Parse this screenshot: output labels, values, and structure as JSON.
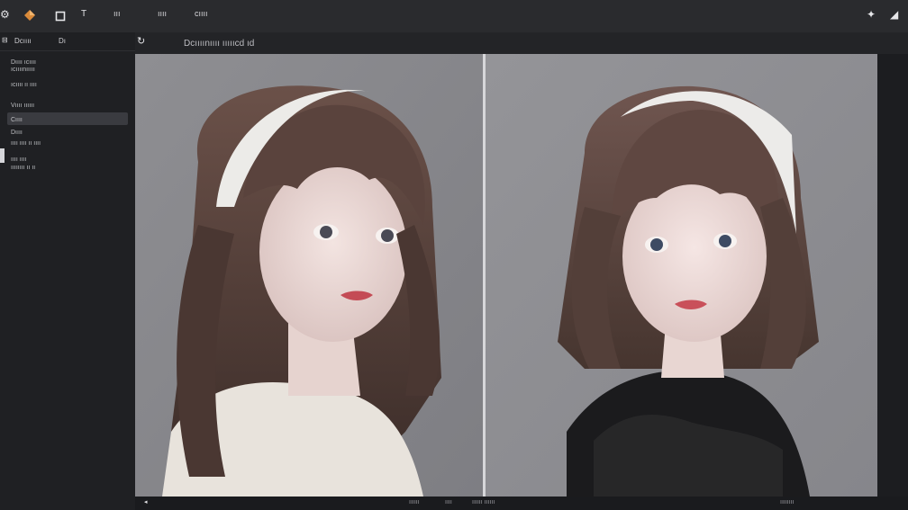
{
  "topbar": {
    "items": [
      "ııı",
      "ıııı",
      "cıııı"
    ],
    "logo_icon": "diamond-logo-icon",
    "accent": "#d98a3a"
  },
  "subbar": {
    "title": "Dcıııınıııı ıııııcd ıd"
  },
  "sidebar": {
    "tabs": [
      "Dcıııı",
      "Dı"
    ],
    "rows": [
      "Dıııı ıcıııı",
      "ıcıııınııııı",
      "ıcıııı ıı ıııı",
      "Vıııı ıııııı",
      "Cıııı",
      "Dıııı",
      "ıııı ıııı ıı ıııı",
      "ıııı ıııı",
      "ıııııııı ıı ıı"
    ]
  },
  "statusbar": {
    "items": [
      "ıııııı",
      "ıııı",
      "ıııııı ıııııı",
      "ıııııııı"
    ]
  }
}
